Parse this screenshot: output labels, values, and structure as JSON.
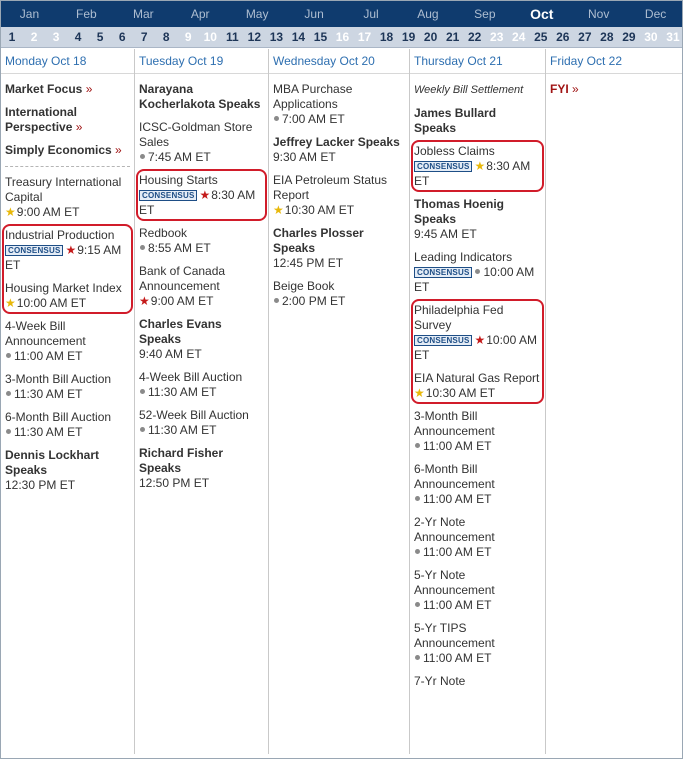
{
  "months": [
    {
      "label": "Jan",
      "active": false
    },
    {
      "label": "Feb",
      "active": false
    },
    {
      "label": "Mar",
      "active": false
    },
    {
      "label": "Apr",
      "active": false
    },
    {
      "label": "May",
      "active": false
    },
    {
      "label": "Jun",
      "active": false
    },
    {
      "label": "Jul",
      "active": false
    },
    {
      "label": "Aug",
      "active": false
    },
    {
      "label": "Sep",
      "active": false
    },
    {
      "label": "Oct",
      "active": true
    },
    {
      "label": "Nov",
      "active": false
    },
    {
      "label": "Dec",
      "active": false
    }
  ],
  "days": [
    {
      "label": "1",
      "weekend": false
    },
    {
      "label": "2",
      "weekend": true
    },
    {
      "label": "3",
      "weekend": true
    },
    {
      "label": "4",
      "weekend": false
    },
    {
      "label": "5",
      "weekend": false
    },
    {
      "label": "6",
      "weekend": false
    },
    {
      "label": "7",
      "weekend": false
    },
    {
      "label": "8",
      "weekend": false
    },
    {
      "label": "9",
      "weekend": true
    },
    {
      "label": "10",
      "weekend": true
    },
    {
      "label": "11",
      "weekend": false
    },
    {
      "label": "12",
      "weekend": false
    },
    {
      "label": "13",
      "weekend": false
    },
    {
      "label": "14",
      "weekend": false
    },
    {
      "label": "15",
      "weekend": false
    },
    {
      "label": "16",
      "weekend": true
    },
    {
      "label": "17",
      "weekend": true
    },
    {
      "label": "18",
      "weekend": false
    },
    {
      "label": "19",
      "weekend": false
    },
    {
      "label": "20",
      "weekend": false
    },
    {
      "label": "21",
      "weekend": false
    },
    {
      "label": "22",
      "weekend": false
    },
    {
      "label": "23",
      "weekend": true
    },
    {
      "label": "24",
      "weekend": true
    },
    {
      "label": "25",
      "weekend": false
    },
    {
      "label": "26",
      "weekend": false
    },
    {
      "label": "27",
      "weekend": false
    },
    {
      "label": "28",
      "weekend": false
    },
    {
      "label": "29",
      "weekend": false
    },
    {
      "label": "30",
      "weekend": true
    },
    {
      "label": "31",
      "weekend": true
    }
  ],
  "consensus_label": "CONSENSUS",
  "colors": {
    "highlight": "#d11c2a",
    "nav_bg": "#0f3b6e",
    "header_text": "#2e6fb0",
    "star_red": "#c41a1a",
    "star_gold": "#e8b80a"
  },
  "columns": [
    {
      "header": "Monday Oct 18",
      "events": [
        {
          "name": "Market Focus",
          "bold": true,
          "raquo": "»"
        },
        {
          "name": "International Perspective",
          "bold": true,
          "raquo": "»"
        },
        {
          "name": "Simply Economics",
          "bold": true,
          "raquo": "»",
          "sep_after": true
        },
        {
          "name": "Treasury International Capital",
          "star": "gold",
          "time": "9:00 AM ET"
        },
        {
          "name": "Industrial Production",
          "consensus": true,
          "star": "red",
          "time": "9:15 AM ET",
          "hl": "start"
        },
        {
          "name": "Housing Market Index",
          "star": "gold",
          "time": "10:00 AM ET",
          "hl": "end"
        },
        {
          "name": "4-Week Bill Announcement",
          "dot": true,
          "time": "11:00 AM ET"
        },
        {
          "name": "3-Month Bill Auction",
          "dot": true,
          "time": "11:30 AM ET"
        },
        {
          "name": "6-Month Bill Auction",
          "dot": true,
          "time": "11:30 AM ET"
        },
        {
          "name": "Dennis Lockhart Speaks",
          "bold": true,
          "time": "12:30 PM ET"
        }
      ]
    },
    {
      "header": "Tuesday Oct 19",
      "events": [
        {
          "name": "Narayana Kocherlakota Speaks",
          "bold": true
        },
        {
          "name": "ICSC-Goldman Store Sales",
          "dot": true,
          "time": "7:45 AM ET"
        },
        {
          "name": "Housing Starts",
          "consensus": true,
          "star": "red",
          "time": "8:30 AM ET",
          "hl": "single"
        },
        {
          "name": "Redbook",
          "dot": true,
          "time": "8:55 AM ET"
        },
        {
          "name": "Bank of Canada Announcement",
          "star": "red",
          "time": "9:00 AM ET"
        },
        {
          "name": "Charles Evans Speaks",
          "bold": true,
          "time": "9:40 AM ET"
        },
        {
          "name": "4-Week Bill Auction",
          "dot": true,
          "time": "11:30 AM ET"
        },
        {
          "name": "52-Week Bill Auction",
          "dot": true,
          "time": "11:30 AM ET"
        },
        {
          "name": "Richard Fisher Speaks",
          "bold": true,
          "time": "12:50 PM ET"
        }
      ]
    },
    {
      "header": "Wednesday Oct 20",
      "events": [
        {
          "name": "MBA Purchase Applications",
          "dot": true,
          "time": "7:00 AM ET"
        },
        {
          "name": "Jeffrey Lacker Speaks",
          "bold": true,
          "time": "9:30 AM ET"
        },
        {
          "name": "EIA Petroleum Status Report",
          "star": "gold",
          "time": "10:30 AM ET"
        },
        {
          "name": "Charles Plosser Speaks",
          "bold": true,
          "time": "12:45 PM ET"
        },
        {
          "name": "Beige Book",
          "dot": true,
          "time": "2:00 PM ET"
        }
      ]
    },
    {
      "header": "Thursday Oct 21",
      "events": [
        {
          "name": "Weekly Bill Settlement",
          "italic": true
        },
        {
          "name": "James Bullard Speaks",
          "bold": true
        },
        {
          "name": "Jobless Claims",
          "consensus": true,
          "star": "gold",
          "time": "8:30 AM ET",
          "hl": "single"
        },
        {
          "name": "Thomas Hoenig Speaks",
          "bold": true,
          "time": "9:45 AM ET"
        },
        {
          "name": "Leading Indicators",
          "consensus": true,
          "dot": true,
          "time": "10:00 AM ET"
        },
        {
          "name": "Philadelphia Fed Survey",
          "consensus": true,
          "star": "red",
          "time": "10:00 AM ET",
          "hl": "start"
        },
        {
          "name": "EIA Natural Gas Report",
          "star": "gold",
          "time": "10:30 AM ET",
          "hl": "end"
        },
        {
          "name": "3-Month Bill Announcement",
          "dot": true,
          "time": "11:00 AM ET"
        },
        {
          "name": "6-Month Bill Announcement",
          "dot": true,
          "time": "11:00 AM ET"
        },
        {
          "name": "2-Yr Note Announcement",
          "dot": true,
          "time": "11:00 AM ET"
        },
        {
          "name": "5-Yr Note Announcement",
          "dot": true,
          "time": "11:00 AM ET"
        },
        {
          "name": "5-Yr TIPS Announcement",
          "dot": true,
          "time": "11:00 AM ET"
        },
        {
          "name": "7-Yr Note",
          "dot": false
        }
      ]
    },
    {
      "header": "Friday Oct 22",
      "events": [
        {
          "name": "FYI",
          "red": true,
          "raquo": "»"
        }
      ]
    }
  ]
}
